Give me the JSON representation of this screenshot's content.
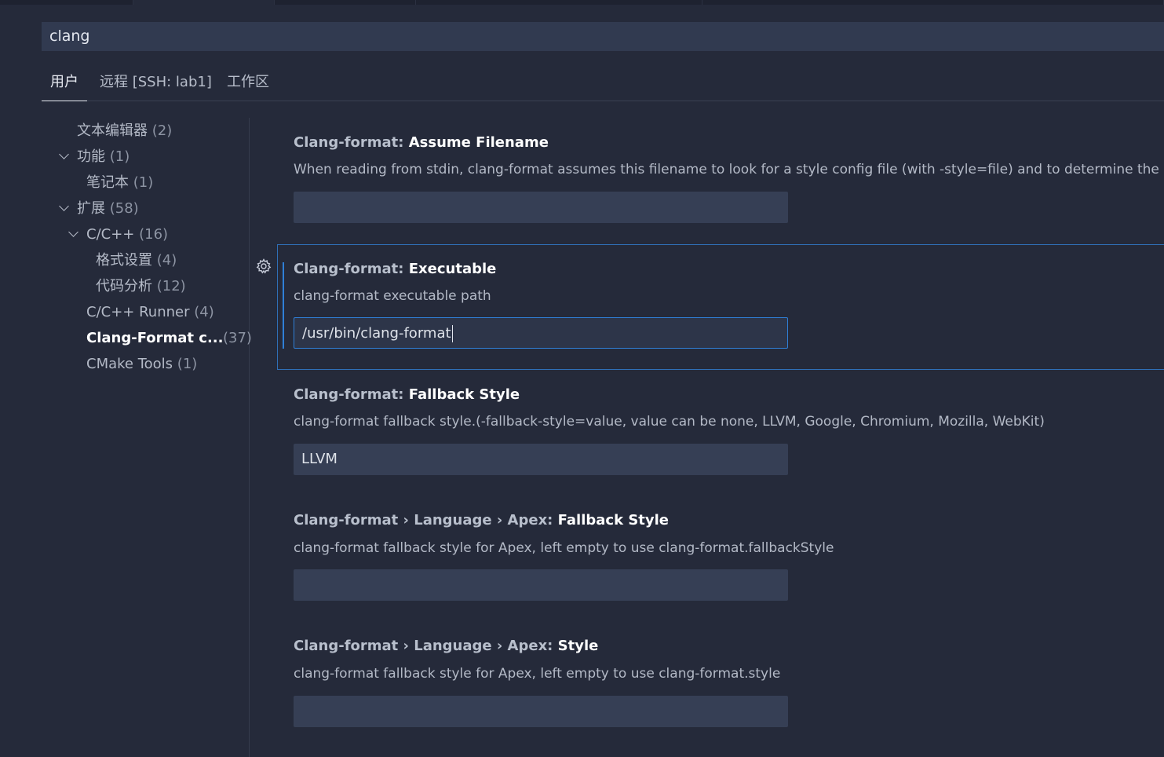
{
  "search": {
    "value": "clang"
  },
  "scopes": [
    {
      "label": "用户",
      "active": true
    },
    {
      "label": "远程 [SSH: lab1]",
      "active": false
    },
    {
      "label": "工作区",
      "active": false
    }
  ],
  "tree": [
    {
      "label": "文本编辑器",
      "count": "(2)",
      "expanded": null
    },
    {
      "label": "功能",
      "count": "(1)",
      "expanded": true
    },
    {
      "label": "笔记本",
      "count": "(1)",
      "expanded": null
    },
    {
      "label": "扩展",
      "count": "(58)",
      "expanded": true
    },
    {
      "label": "C/C++",
      "count": "(16)",
      "expanded": true
    },
    {
      "label": "格式设置",
      "count": "(4)",
      "expanded": null
    },
    {
      "label": "代码分析",
      "count": "(12)",
      "expanded": null
    },
    {
      "label": "C/C++ Runner",
      "count": "(4)",
      "expanded": null
    },
    {
      "label": "Clang-Format c...",
      "count": "(37)",
      "expanded": null,
      "selected": true
    },
    {
      "label": "CMake Tools",
      "count": "(1)",
      "expanded": null
    }
  ],
  "settings": [
    {
      "category": "Clang-format: ",
      "name": "Assume Filename",
      "description": "When reading from stdin, clang-format assumes this filename to look for a style config file (with -style=file) and to determine the",
      "value": ""
    },
    {
      "category": "Clang-format: ",
      "name": "Executable",
      "description": "clang-format executable path",
      "value": "/usr/bin/clang-format",
      "focused": true
    },
    {
      "category": "Clang-format: ",
      "name": "Fallback Style",
      "description": "clang-format fallback style.(-fallback-style=value, value can be none, LLVM, Google, Chromium, Mozilla, WebKit)",
      "value": "LLVM"
    },
    {
      "category": "Clang-format › Language › Apex: ",
      "name": "Fallback Style",
      "description": "clang-format fallback style for Apex, left empty to use clang-format.fallbackStyle",
      "value": ""
    },
    {
      "category": "Clang-format › Language › Apex: ",
      "name": "Style",
      "description": "clang-format fallback style for Apex, left empty to use clang-format.style",
      "value": ""
    }
  ],
  "icons": {
    "focused_setting": "gear-icon",
    "tree_toggle": "chevron-down-icon"
  },
  "colors": {
    "accent": "#2f7fd6",
    "background": "#252a3a",
    "input": "#363f55"
  }
}
